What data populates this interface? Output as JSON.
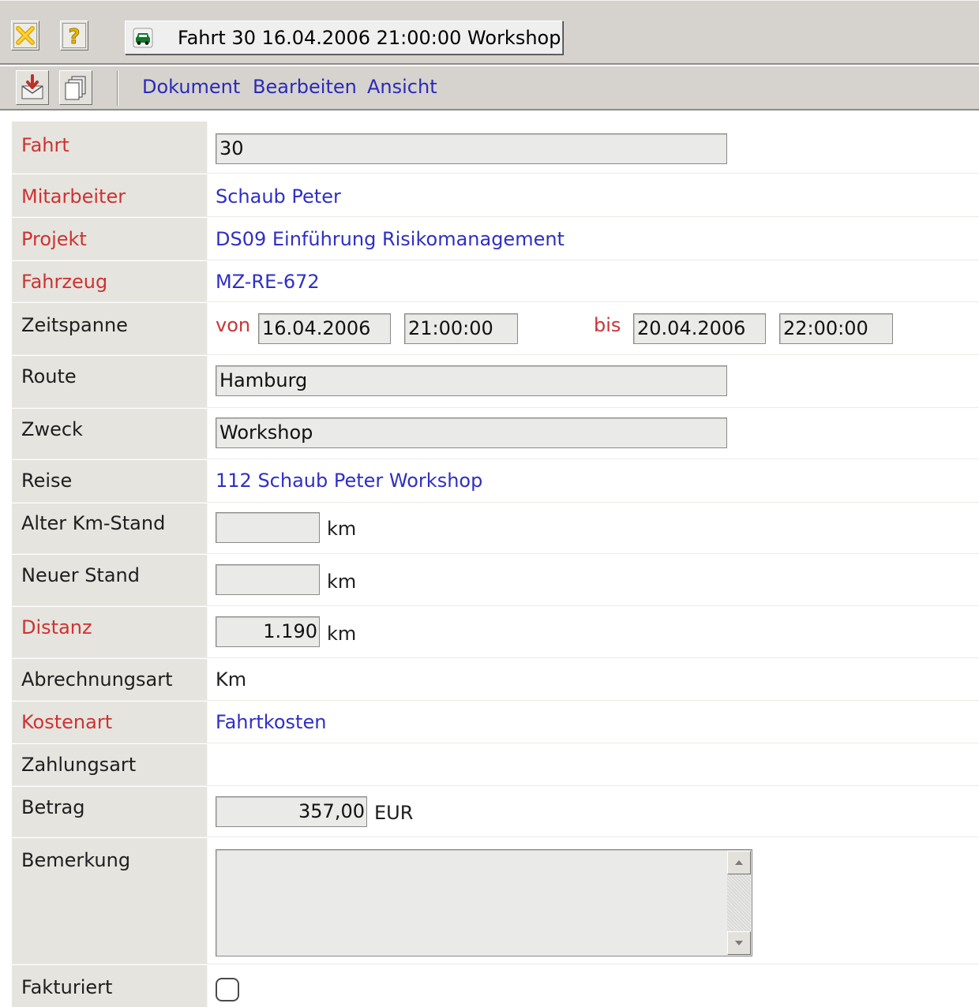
{
  "window": {
    "title": "Fahrt 30 16.04.2006 21:00:00 Workshop",
    "close_icon": "close-x-icon",
    "help_icon": "help-question-icon",
    "car_icon": "car-icon"
  },
  "menu": {
    "items": [
      "Dokument",
      "Bearbeiten",
      "Ansicht"
    ],
    "toolbar_icons": [
      "save-document-icon",
      "copy-document-icon"
    ]
  },
  "form": {
    "fahrt": {
      "label": "Fahrt",
      "value": "30"
    },
    "mitarbeiter": {
      "label": "Mitarbeiter",
      "value": "Schaub Peter"
    },
    "projekt": {
      "label": "Projekt",
      "value": "DS09 Einführung Risikomanagement"
    },
    "fahrzeug": {
      "label": "Fahrzeug",
      "value": "MZ-RE-672"
    },
    "zeitspanne": {
      "label": "Zeitspanne",
      "von_label": "von",
      "von_date": "16.04.2006",
      "von_time": "21:00:00",
      "bis_label": "bis",
      "bis_date": "20.04.2006",
      "bis_time": "22:00:00"
    },
    "route": {
      "label": "Route",
      "value": "Hamburg"
    },
    "zweck": {
      "label": "Zweck",
      "value": "Workshop"
    },
    "reise": {
      "label": "Reise",
      "value": "112 Schaub Peter Workshop"
    },
    "alter_km": {
      "label": "Alter Km-Stand",
      "value": "",
      "unit": "km"
    },
    "neuer_stand": {
      "label": "Neuer Stand",
      "value": "",
      "unit": "km"
    },
    "distanz": {
      "label": "Distanz",
      "value": "1.190",
      "unit": "km"
    },
    "abrechnungsart": {
      "label": "Abrechnungsart",
      "value": "Km"
    },
    "kostenart": {
      "label": "Kostenart",
      "value": "Fahrtkosten"
    },
    "zahlungsart": {
      "label": "Zahlungsart",
      "value": ""
    },
    "betrag": {
      "label": "Betrag",
      "value": "357,00",
      "unit": "EUR"
    },
    "bemerkung": {
      "label": "Bemerkung",
      "value": ""
    },
    "fakturiert": {
      "label": "Fakturiert",
      "checked": false
    }
  },
  "colors": {
    "required_label": "#cc3333",
    "link": "#2f2fc4",
    "chrome": "#d6d3ce"
  }
}
